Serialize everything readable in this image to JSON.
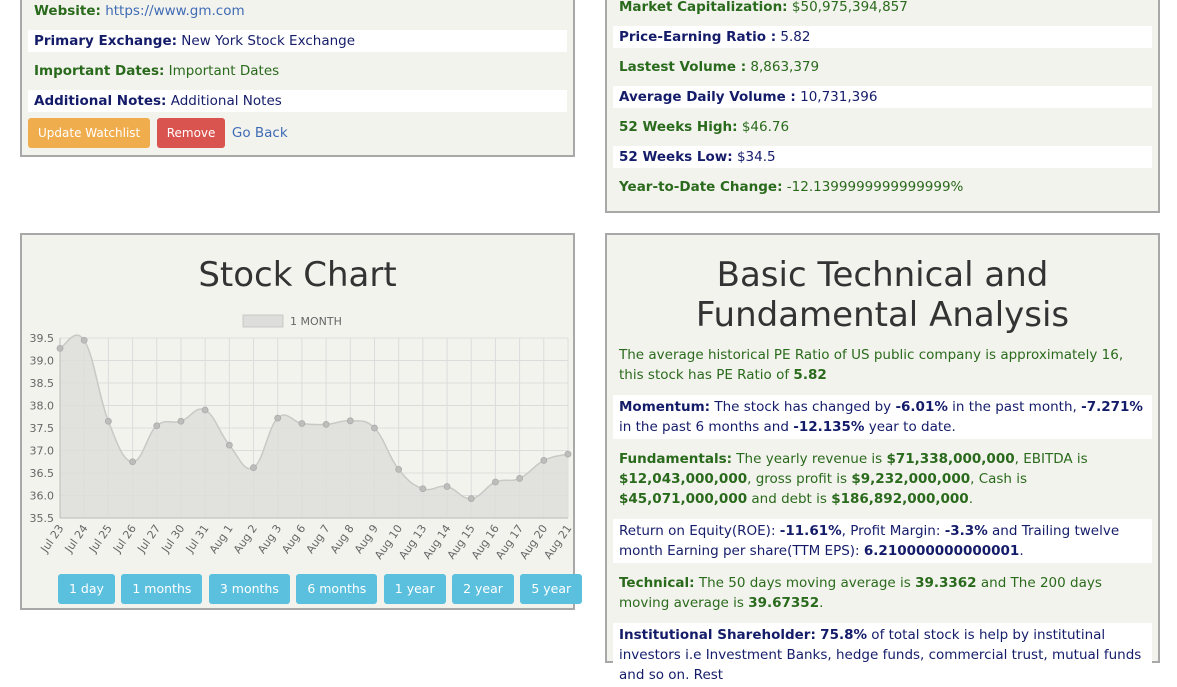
{
  "details": {
    "website_label": "Website:",
    "website_value": "https://www.gm.com",
    "exchange_label": "Primary Exchange:",
    "exchange_value": "New York Stock Exchange",
    "dates_label": "Important Dates:",
    "dates_value": "Important Dates",
    "notes_label": "Additional Notes:",
    "notes_value": "Additional Notes",
    "update_btn": "Update Watchlist",
    "remove_btn": "Remove",
    "back_link": "Go Back"
  },
  "stats": {
    "market_cap_label": "Market Capitalization:",
    "market_cap_value": "$50,975,394,857",
    "pe_label": "Price-Earning Ratio :",
    "pe_value": "5.82",
    "volume_label": "Lastest Volume :",
    "volume_value": "8,863,379",
    "avg_volume_label": "Average Daily Volume :",
    "avg_volume_value": "10,731,396",
    "high_label": "52 Weeks High:",
    "high_value": "$46.76",
    "low_label": "52 Weeks Low:",
    "low_value": "$34.5",
    "ytd_label": "Year-to-Date Change:",
    "ytd_value": "-12.1399999999999999%"
  },
  "chart_panel": {
    "title": "Stock Chart",
    "ranges": [
      "1 day",
      "1 months",
      "3 months",
      "6 months",
      "1 year",
      "2 year",
      "5 year"
    ]
  },
  "chart_data": {
    "type": "area",
    "legend": "1 MONTH",
    "categories": [
      "Jul 23",
      "Jul 24",
      "Jul 25",
      "Jul 26",
      "Jul 27",
      "Jul 30",
      "Jul 31",
      "Aug 1",
      "Aug 2",
      "Aug 3",
      "Aug 6",
      "Aug 7",
      "Aug 8",
      "Aug 9",
      "Aug 10",
      "Aug 13",
      "Aug 14",
      "Aug 15",
      "Aug 16",
      "Aug 17",
      "Aug 20",
      "Aug 21"
    ],
    "values": [
      39.27,
      39.45,
      37.65,
      36.75,
      37.55,
      37.65,
      37.9,
      37.12,
      36.62,
      37.72,
      37.6,
      37.58,
      37.66,
      37.5,
      36.58,
      36.15,
      36.2,
      35.93,
      36.3,
      36.38,
      36.78,
      36.92
    ],
    "ylim": [
      35.5,
      39.5
    ],
    "yticks": [
      "39.5",
      "39.0",
      "38.5",
      "38.0",
      "37.5",
      "37.0",
      "36.5",
      "36.0",
      "35.5"
    ],
    "colors": {
      "fill": "#dddddb",
      "line": "#c8c8c5",
      "point": "#bdbdbb"
    },
    "grid": true
  },
  "analysis": {
    "title_line1": "Basic Technical and",
    "title_line2": "Fundamental Analysis",
    "pe_text_a": "The average historical PE Ratio of US public company is approximately 16, this stock has PE Ratio of ",
    "pe_value": "5.82",
    "momentum_label": "Momentum:",
    "momentum_a": " The stock has changed by ",
    "momentum_month": "-6.01%",
    "momentum_b": " in the past month, ",
    "momentum_6m": "-7.271%",
    "momentum_c": " in the past 6 months and ",
    "momentum_ytd": "-12.135%",
    "momentum_d": " year to date.",
    "fund_label": "Fundamentals:",
    "fund_a": " The yearly revenue is ",
    "fund_revenue": "$71,338,000,000",
    "fund_b": ", EBITDA is ",
    "fund_ebitda": "$12,043,000,000",
    "fund_c": ", gross profit is ",
    "fund_gross": "$9,232,000,000",
    "fund_d": ", Cash is ",
    "fund_cash": "$45,071,000,000",
    "fund_e": " and debt is ",
    "fund_debt": "$186,892,000,000",
    "fund_f": ".",
    "roe_a": "Return on Equity(ROE): ",
    "roe_value": "-11.61%",
    "roe_b": ", Profit Margin: ",
    "margin_value": "-3.3%",
    "roe_c": " and Trailing twelve month Earning per share(TTM EPS): ",
    "eps_value": "6.210000000000001",
    "roe_d": ".",
    "tech_label": "Technical:",
    "tech_a": " The 50 days moving average is ",
    "ma50": "39.3362",
    "tech_b": " and The 200 days moving average is ",
    "ma200": "39.67352",
    "tech_c": ".",
    "inst_label": "Institutional Shareholder:",
    "inst_value": "75.8%",
    "inst_text": " of total stock is help by institutinal investors i.e Investment Banks, hedge funds, commercial trust, mutual funds and so on. Rest"
  }
}
